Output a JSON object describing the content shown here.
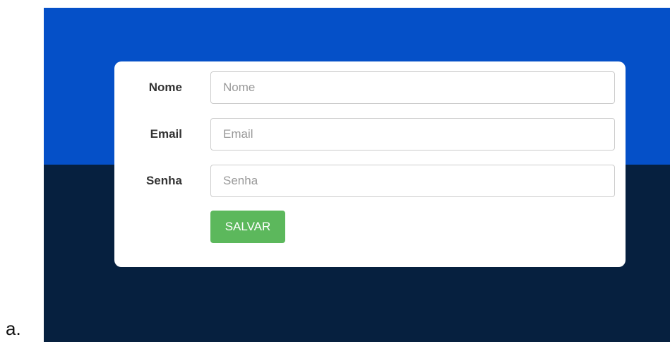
{
  "list_marker": "a.",
  "form": {
    "fields": [
      {
        "label": "Nome",
        "placeholder": "Nome",
        "value": ""
      },
      {
        "label": "Email",
        "placeholder": "Email",
        "value": ""
      },
      {
        "label": "Senha",
        "placeholder": "Senha",
        "value": ""
      }
    ],
    "save_label": "SALVAR"
  },
  "colors": {
    "top_band": "#0550c8",
    "bottom_band": "#06203f",
    "card_background": "#ffffff",
    "save_button": "#5cb85c",
    "label_text": "#333333"
  }
}
